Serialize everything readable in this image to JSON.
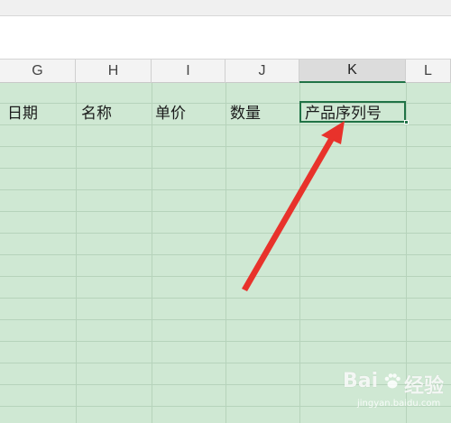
{
  "columns": [
    {
      "label": "G"
    },
    {
      "label": "H"
    },
    {
      "label": "I"
    },
    {
      "label": "J"
    },
    {
      "label": "K",
      "selected": true
    },
    {
      "label": "L"
    }
  ],
  "row1": {
    "g": "日期",
    "h": "名称",
    "i": "单价",
    "j": "数量",
    "k": "产品序列号"
  },
  "watermark": {
    "text_left": "Bai",
    "text_right": "经验",
    "url": "jingyan.baidu.com"
  },
  "colors": {
    "sheet_fill": "#cfe8d3",
    "selection": "#217346",
    "arrow": "#e8322b"
  }
}
